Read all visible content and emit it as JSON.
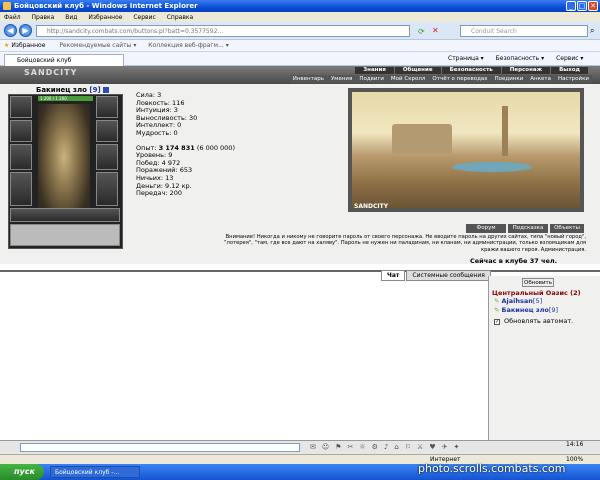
{
  "browser": {
    "window_title": "Бойцовский клуб - Windows Internet Explorer",
    "menu": [
      "Файл",
      "Правка",
      "Вид",
      "Избранное",
      "Сервис",
      "Справка"
    ],
    "url": "http://sandcity.combats.com/buttons.pl?batt=0.3577592...",
    "search_placeholder": "Conduit Search",
    "favorites_label": "Избранное",
    "fav_items": [
      "Рекомендуемые сайты ▾",
      "Коллекция веб-фрагм... ▾"
    ],
    "tab_title": "Бойцовский клуб",
    "toolbar_right": [
      "Страница ▾",
      "Безопасность ▾",
      "Сервис ▾"
    ]
  },
  "game_nav": {
    "logo": "SANDCITY",
    "top": [
      "Знания",
      "Общение",
      "Безопасность",
      "Персонаж",
      "Выход"
    ],
    "sub": [
      "Инвентарь",
      "Умения",
      "Подвиги",
      "Мой Скролл",
      "Отчёт о переводах",
      "Поединки",
      "Анкета",
      "Настройки"
    ]
  },
  "character": {
    "name": "Бакинец зло",
    "level": "[9]",
    "hp": "1 200 / 1 200",
    "stats": [
      "Сила: 3",
      "Ловкость: 116",
      "Интуиция: 3",
      "Выносливость: 30",
      "Интеллект: 0",
      "Мудрость: 0"
    ],
    "exp_label": "Опыт:",
    "exp": "3 174 831",
    "exp_next": "(6 000 000)",
    "info": [
      "Уровень: 9",
      "Побед: 4 972",
      "Поражений: 653",
      "Ничьих: 13"
    ],
    "money": "Деньги: 9.12 кр.",
    "transfers": "Передач: 200"
  },
  "location": {
    "scene_label": "SANDCITY",
    "buttons": [
      "Форум",
      "Подсказка",
      "Объекты"
    ],
    "warning": "Внимание! Никогда и никому не говорите пароль от своего персонажа. Не вводите пароль на других сайтах, типа \"новый город\", \"лотерея\", \"там, где все дают на халяву\". Пароль не нужен ни паладинам, ни кланам, ни администрации, только взломщикам для кражи вашего героя. Администрация.",
    "online": "Сейчас в клубе 37 чел."
  },
  "chat": {
    "tabs": [
      "Чат",
      "Системные сообщения"
    ],
    "refresh_button": "Обновить",
    "room": "Центральный Оазис (2)",
    "users": [
      {
        "name": "Ajaihsan",
        "level": "[5]"
      },
      {
        "name": "Бакинец зло",
        "level": "[9]"
      }
    ],
    "auto_refresh": "Обновлять автомат.",
    "clock": "14:16"
  },
  "status_bar": {
    "zone": "Интернет",
    "zoom": "100%"
  },
  "taskbar": {
    "start": "пуск",
    "window": "Бойцовский клуб -..."
  },
  "watermark": "photo.scrolls.combats.com"
}
